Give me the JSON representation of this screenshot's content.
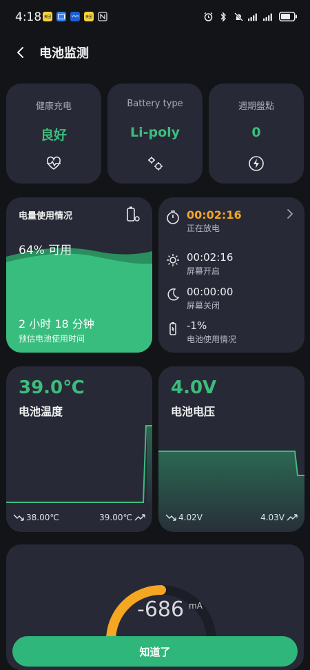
{
  "status_bar": {
    "time": "4:18",
    "app_icons": [
      {
        "name": "meituan-app-icon",
        "label": "美团",
        "color": "#f7d23a"
      },
      {
        "name": "message-app-icon",
        "label": "",
        "color": "#2f7ff0"
      },
      {
        "name": "vivo-app-icon",
        "label": "vivo",
        "color": "#1c5fd4"
      },
      {
        "name": "meituan2-app-icon",
        "label": "美团",
        "color": "#f7d23a"
      }
    ],
    "right_icons": [
      "alarm-icon",
      "bluetooth-icon",
      "mute-icon",
      "signal-icon",
      "signal2-icon",
      "battery-icon"
    ]
  },
  "header": {
    "title": "电池监测"
  },
  "top_cards": [
    {
      "label": "健康充电",
      "value": "良好",
      "icon": "heart-pulse-icon"
    },
    {
      "label": "Battery type",
      "value": "Li-poly",
      "icon": "gears-icon"
    },
    {
      "label": "週期盤點",
      "value": "0",
      "icon": "charge-bolt-icon"
    }
  ],
  "usage": {
    "title": "电量使用情况",
    "percent_text": "64% 可用",
    "percent_value": 64,
    "remaining_time": "2 小时 18 分钟",
    "remaining_label": "预估电池使用时间"
  },
  "timers": [
    {
      "value": "00:02:16",
      "label": "正在放电",
      "icon": "stopwatch-icon"
    },
    {
      "value": "00:02:16",
      "label": "屏幕开启",
      "icon": "sun-icon"
    },
    {
      "value": "00:00:00",
      "label": "屏幕关闭",
      "icon": "moon-icon"
    },
    {
      "value": "-1%",
      "label": "电池使用情况",
      "icon": "battery-small-icon"
    }
  ],
  "temperature": {
    "value": "39.0℃",
    "label": "电池温度",
    "min": "38.00℃",
    "max": "39.00℃"
  },
  "voltage": {
    "value": "4.0V",
    "label": "电池电压",
    "min": "4.02V",
    "max": "4.03V"
  },
  "current": {
    "value": "-686",
    "unit": "mA"
  },
  "button": {
    "ok_label": "知道了"
  },
  "colors": {
    "accent_green": "#3dbd7d",
    "accent_orange": "#f5a623",
    "card_bg": "#272a36",
    "page_bg": "#131418"
  }
}
